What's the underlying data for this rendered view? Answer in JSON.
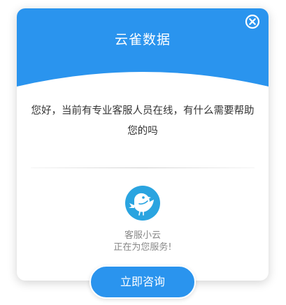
{
  "header": {
    "title": "云雀数据"
  },
  "greeting": {
    "text": "您好，当前有专业客服人员在线，有什么需要帮助您的吗"
  },
  "agent": {
    "name": "客服小云",
    "status": "正在为您服务!"
  },
  "actions": {
    "consult_label": "立即咨询",
    "close_icon": "close-circle-icon"
  },
  "colors": {
    "header_blue": "#2a94ee",
    "avatar_blue": "#2aa4e0",
    "button_blue": "#2a94ee"
  }
}
